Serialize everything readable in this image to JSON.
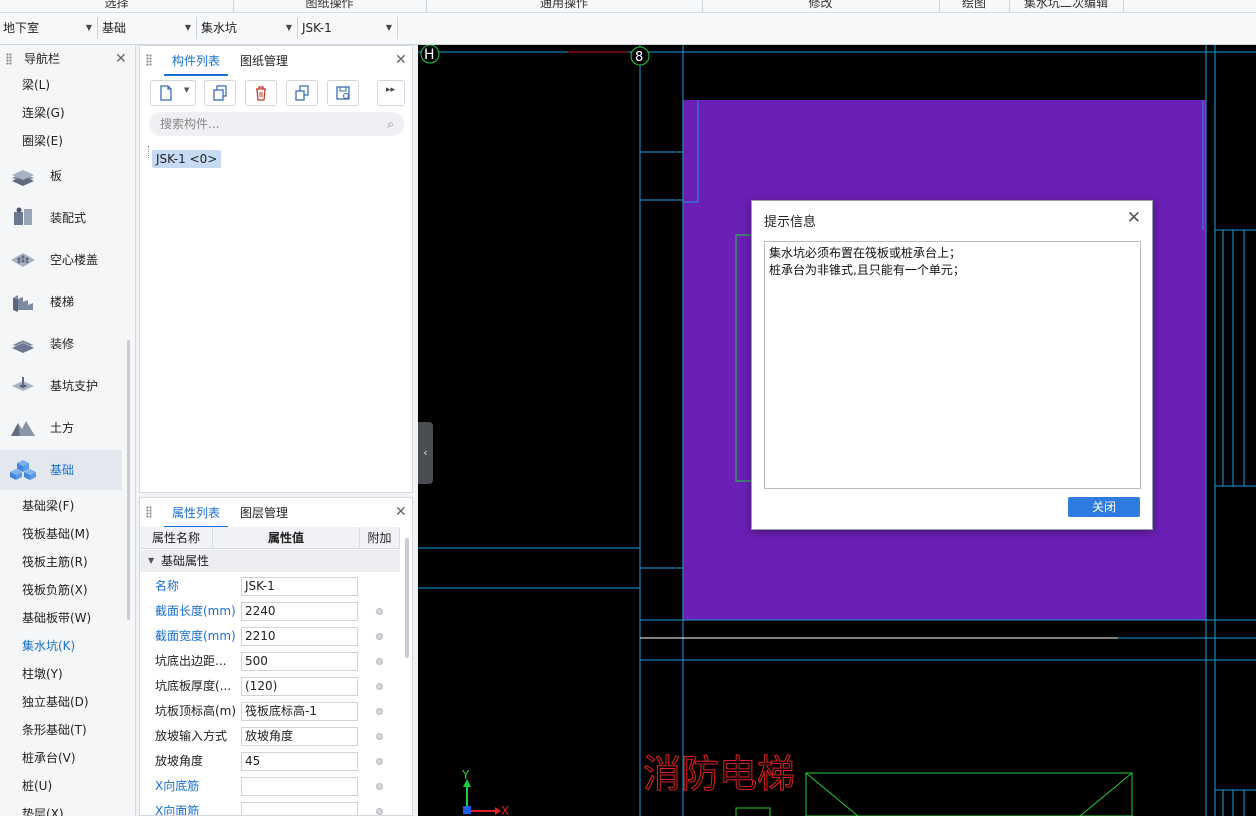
{
  "ribbon": {
    "groups": [
      "选择",
      "图纸操作",
      "通用操作",
      "修改",
      "绘图",
      "集水坑二次编辑"
    ]
  },
  "selectors": {
    "floor": "地下室",
    "category": "基础",
    "component_type": "集水坑",
    "component": "JSK-1"
  },
  "nav": {
    "title": "导航栏",
    "items_top": [
      "梁(L)",
      "连梁(G)",
      "圈梁(E)"
    ],
    "categories": [
      "板",
      "装配式",
      "空心楼盖",
      "楼梯",
      "装修",
      "基坑支护",
      "土方",
      "基础"
    ],
    "active_category": "基础",
    "items_bottom": [
      "基础梁(F)",
      "筏板基础(M)",
      "筏板主筋(R)",
      "筏板负筋(X)",
      "基础板带(W)",
      "集水坑(K)",
      "柱墩(Y)",
      "独立基础(D)",
      "条形基础(T)",
      "桩承台(V)",
      "桩(U)",
      "垫层(X)"
    ],
    "active_item": "集水坑(K)"
  },
  "component_panel": {
    "tab_active": "构件列表",
    "tab_other": "图纸管理",
    "search_placeholder": "搜索构件...",
    "tree_item": "JSK-1 <0>"
  },
  "property_panel": {
    "tab_active": "属性列表",
    "tab_other": "图层管理",
    "col_name": "属性名称",
    "col_value": "属性值",
    "col_extra": "附加",
    "group": "基础属性",
    "rows": [
      {
        "name": "名称",
        "value": "JSK-1",
        "blue": true,
        "dot": false
      },
      {
        "name": "截面长度(mm)",
        "value": "2240",
        "blue": true,
        "dot": true
      },
      {
        "name": "截面宽度(mm)",
        "value": "2210",
        "blue": true,
        "dot": true
      },
      {
        "name": "坑底出边距...",
        "value": "500",
        "blue": false,
        "dot": true
      },
      {
        "name": "坑底板厚度(...",
        "value": "(120)",
        "blue": false,
        "dot": true
      },
      {
        "name": "坑板顶标高(m)",
        "value": "筏板底标高-1",
        "blue": false,
        "dot": true
      },
      {
        "name": "放坡输入方式",
        "value": "放坡角度",
        "blue": false,
        "dot": true
      },
      {
        "name": "放坡角度",
        "value": "45",
        "blue": false,
        "dot": true
      },
      {
        "name": "X向底筋",
        "value": "",
        "blue": true,
        "dot": true
      },
      {
        "name": "X向面筋",
        "value": "",
        "blue": true,
        "dot": true
      }
    ]
  },
  "canvas": {
    "axis_h": "H",
    "axis_8": "8",
    "elevator_text": "消防电梯",
    "ucs_x": "X",
    "ucs_y": "Y",
    "fill_color": "#6a1fb5",
    "line_color": "#1f9be0"
  },
  "dialog": {
    "title": "提示信息",
    "message_lines": [
      "集水坑必须布置在筏板或桩承台上；",
      "桩承台为非锥式,且只能有一个单元；"
    ],
    "close_button": "关闭"
  }
}
